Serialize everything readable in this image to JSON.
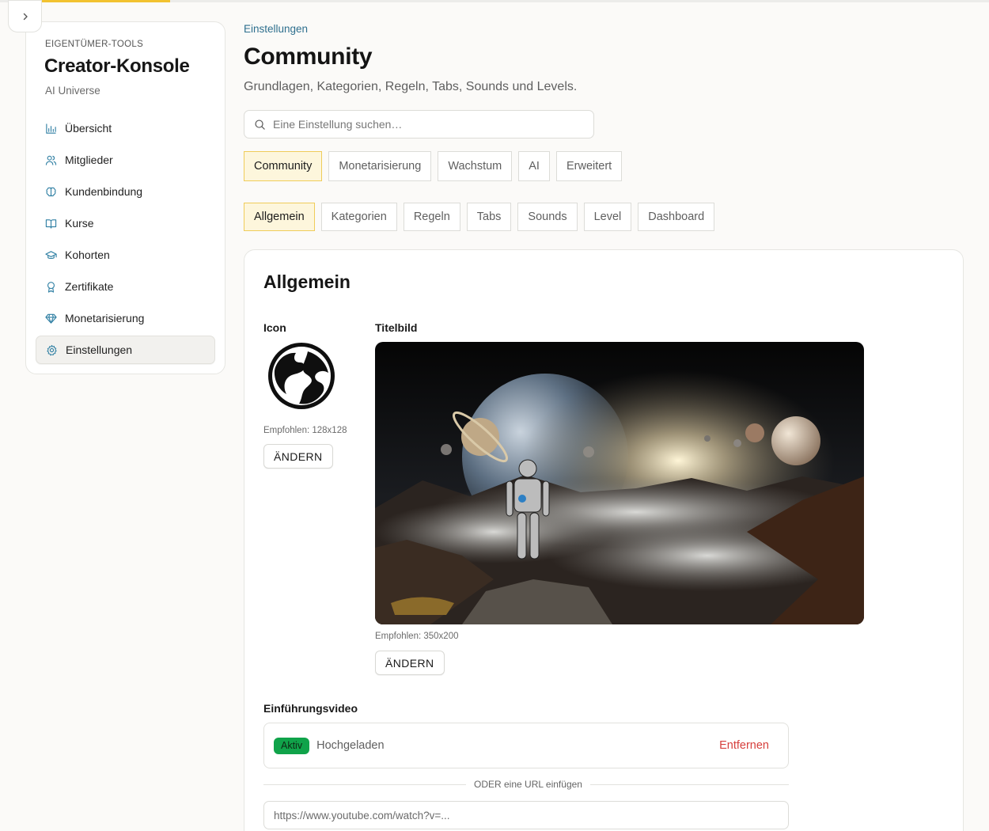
{
  "theme": {
    "accent": "#f2c230",
    "active_tab_bg": "#fdf6dc",
    "active_tab_border": "#efcc5a",
    "link": "#2e6f8e",
    "danger": "#d6403d",
    "success": "#10a34a"
  },
  "top_progress": {
    "fraction": 0.16
  },
  "sidebar": {
    "collapse_icon": "chevron-right-icon",
    "overline": "EIGENTÜMER-TOOLS",
    "title": "Creator-Konsole",
    "subtitle": "AI Universe",
    "items": [
      {
        "label": "Übersicht",
        "icon": "bar-chart-icon",
        "active": false
      },
      {
        "label": "Mitglieder",
        "icon": "users-icon",
        "active": false
      },
      {
        "label": "Kundenbindung",
        "icon": "brain-icon",
        "active": false
      },
      {
        "label": "Kurse",
        "icon": "book-open-icon",
        "active": false
      },
      {
        "label": "Kohorten",
        "icon": "graduation-cap-icon",
        "active": false
      },
      {
        "label": "Zertifikate",
        "icon": "award-icon",
        "active": false
      },
      {
        "label": "Monetarisierung",
        "icon": "gem-icon",
        "active": false
      },
      {
        "label": "Einstellungen",
        "icon": "gear-icon",
        "active": true
      }
    ]
  },
  "header": {
    "breadcrumb": "Einstellungen",
    "title": "Community",
    "subtitle": "Grundlagen, Kategorien, Regeln, Tabs, Sounds und Levels."
  },
  "search": {
    "placeholder": "Eine Einstellung suchen…",
    "value": "",
    "icon": "search-icon"
  },
  "main_tabs": [
    {
      "label": "Community",
      "active": true
    },
    {
      "label": "Monetarisierung",
      "active": false
    },
    {
      "label": "Wachstum",
      "active": false
    },
    {
      "label": "AI",
      "active": false
    },
    {
      "label": "Erweitert",
      "active": false
    }
  ],
  "sub_tabs": [
    {
      "label": "Allgemein",
      "active": true
    },
    {
      "label": "Kategorien",
      "active": false
    },
    {
      "label": "Regeln",
      "active": false
    },
    {
      "label": "Tabs",
      "active": false
    },
    {
      "label": "Sounds",
      "active": false
    },
    {
      "label": "Level",
      "active": false
    },
    {
      "label": "Dashboard",
      "active": false
    }
  ],
  "card": {
    "title": "Allgemein",
    "icon_field": {
      "label": "Icon",
      "hint": "Empfohlen: 128x128",
      "button": "ÄNDERN"
    },
    "cover_field": {
      "label": "Titelbild",
      "hint": "Empfohlen: 350x200",
      "button": "ÄNDERN"
    },
    "video": {
      "label": "Einführungsvideo",
      "badge": "Aktiv",
      "status": "Hochgeladen",
      "remove": "Entfernen",
      "divider": "ODER eine URL einfügen",
      "url_placeholder": "https://www.youtube.com/watch?v=...",
      "url_value": ""
    }
  }
}
